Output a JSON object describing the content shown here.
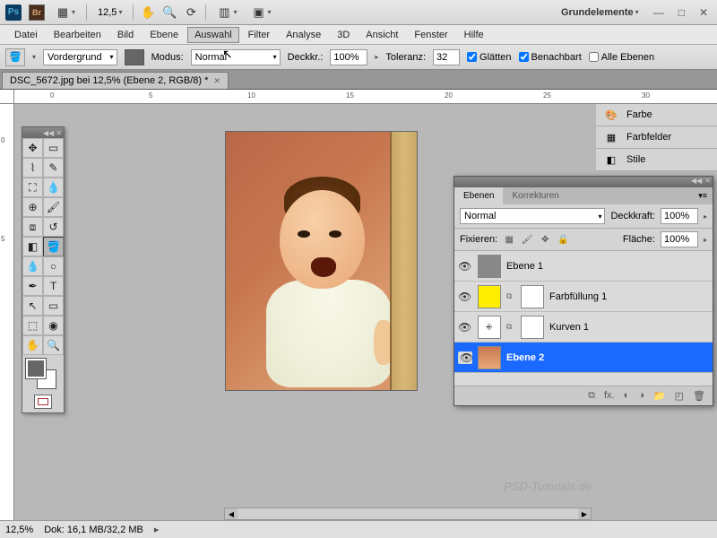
{
  "topbar": {
    "zoom": "12,5",
    "workspace": "Grundelemente"
  },
  "menu": [
    "Datei",
    "Bearbeiten",
    "Bild",
    "Ebene",
    "Auswahl",
    "Filter",
    "Analyse",
    "3D",
    "Ansicht",
    "Fenster",
    "Hilfe"
  ],
  "menu_active_index": 4,
  "options": {
    "fill_target": "Vordergrund",
    "mode_label": "Modus:",
    "mode_value": "Normal",
    "opacity_label": "Deckkr.:",
    "opacity_value": "100%",
    "tolerance_label": "Toleranz:",
    "tolerance_value": "32",
    "antialias": "Glätten",
    "contiguous": "Benachbart",
    "all_layers": "Alle Ebenen"
  },
  "doc_tab": "DSC_5672.jpg bei 12,5% (Ebene 2, RGB/8) *",
  "ruler_h": [
    "0",
    "5",
    "10",
    "15",
    "20",
    "25",
    "30"
  ],
  "ruler_v": [
    "0",
    "5"
  ],
  "right_panels": {
    "p0": "Farbe",
    "p1": "Farbfelder",
    "p2": "Stile"
  },
  "layers_panel": {
    "tab0": "Ebenen",
    "tab1": "Korrekturen",
    "blend_mode": "Normal",
    "opacity_label": "Deckkraft:",
    "opacity_value": "100%",
    "lock_label": "Fixieren:",
    "fill_label": "Fläche:",
    "fill_value": "100%",
    "layers": {
      "l0": "Ebene 1",
      "l1": "Farbfüllung 1",
      "l2": "Kurven 1",
      "l3": "Ebene 2"
    },
    "selected": 3
  },
  "status": {
    "zoom": "12,5%",
    "doc": "Dok: 16,1 MB/32,2 MB"
  },
  "watermark": "PSD-Tutorials.de"
}
